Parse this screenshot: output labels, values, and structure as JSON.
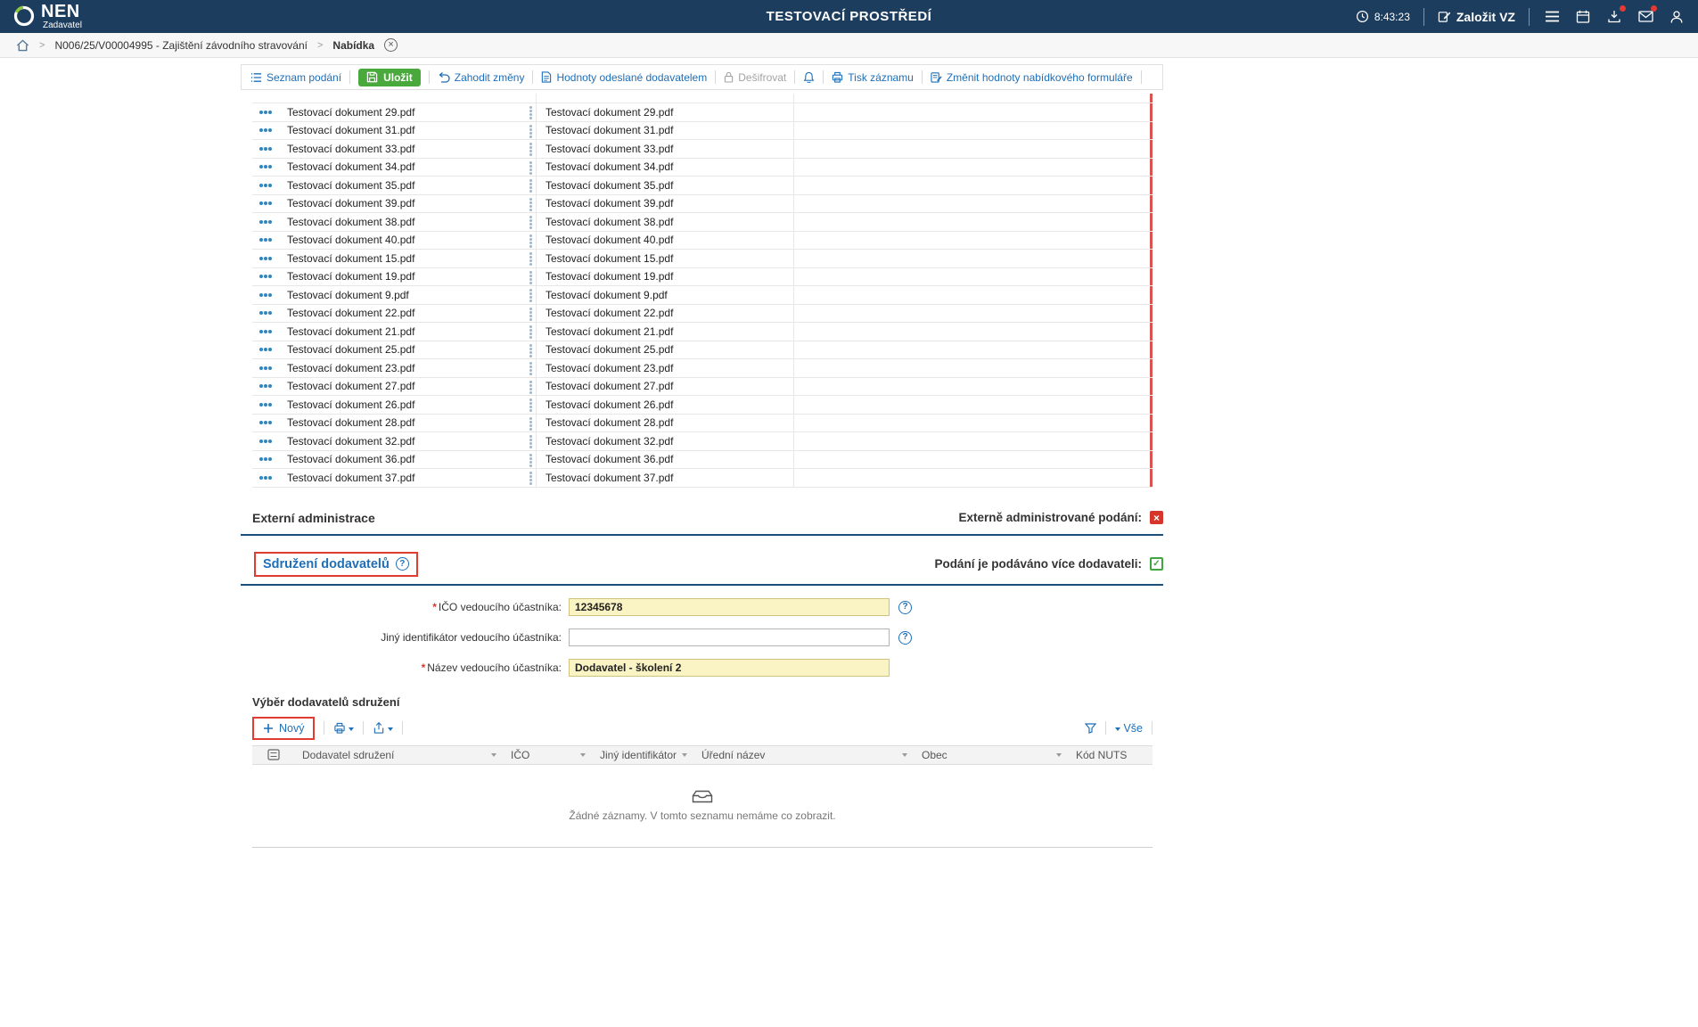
{
  "topbar": {
    "logo": "NEN",
    "logo_subtitle": "Zadavatel",
    "title": "TESTOVACÍ PROSTŘEDÍ",
    "time": "8:43:23",
    "create_button": "Založit VZ"
  },
  "breadcrumb": {
    "project": "N006/25/V00004995 - Zajištění závodního stravování",
    "current": "Nabídka"
  },
  "toolbar": {
    "seznam": "Seznam podání",
    "ulozit": "Uložit",
    "zahodit": "Zahodit změny",
    "hodnoty": "Hodnoty odeslané dodavatelem",
    "desifrovat": "Dešifrovat",
    "tisk": "Tisk záznamu",
    "zmenit": "Změnit hodnoty nabídkového formuláře"
  },
  "documents": {
    "rows": [
      "Testovací dokument 29.pdf",
      "Testovací dokument 31.pdf",
      "Testovací dokument 33.pdf",
      "Testovací dokument 34.pdf",
      "Testovací dokument 35.pdf",
      "Testovací dokument 39.pdf",
      "Testovací dokument 38.pdf",
      "Testovací dokument 40.pdf",
      "Testovací dokument 15.pdf",
      "Testovací dokument 19.pdf",
      "Testovací dokument 9.pdf",
      "Testovací dokument 22.pdf",
      "Testovací dokument 21.pdf",
      "Testovací dokument 25.pdf",
      "Testovací dokument 23.pdf",
      "Testovací dokument 27.pdf",
      "Testovací dokument 26.pdf",
      "Testovací dokument 28.pdf",
      "Testovací dokument 32.pdf",
      "Testovací dokument 36.pdf",
      "Testovací dokument 37.pdf"
    ]
  },
  "external_admin": {
    "title": "Externí administrace",
    "label": "Externě administrované podání:"
  },
  "consortium": {
    "title": "Sdružení dodavatelů",
    "label": "Podání je podáváno více dodavateli:"
  },
  "form": {
    "required_marker": "*",
    "ico_label": "IČO vedoucího účastníka:",
    "ico_value": "12345678",
    "other_label": "Jiný identifikátor vedoucího účastníka:",
    "other_value": "",
    "name_label": "Název vedoucího účastníka:",
    "name_value": "Dodavatel - školení 2"
  },
  "supplier_grid": {
    "title": "Výběr dodavatelů sdružení",
    "new_label": "Nový",
    "filter_all": "Vše",
    "columns": [
      "Dodavatel sdružení",
      "IČO",
      "Jiný identifikátor",
      "Úřední název",
      "Obec",
      "Kód NUTS"
    ],
    "empty_text": "Žádné záznamy. V tomto seznamu nemáme co zobrazit."
  },
  "colors": {
    "topbar_bg": "#1c3d5e",
    "accent_blue": "#1e6fb8",
    "save_green": "#4aa93c",
    "annotation_red": "#e03c31",
    "required_yellow": "#faf3c3",
    "section_line": "#1d4e79"
  }
}
